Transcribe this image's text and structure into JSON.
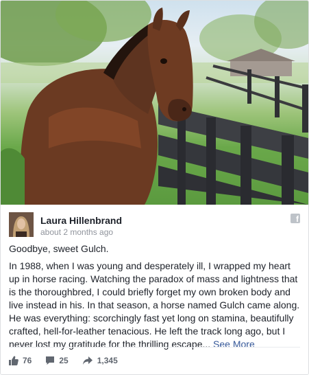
{
  "post": {
    "author": "Laura Hillenbrand",
    "timestamp": "about 2 months ago",
    "intro": "Goodbye, sweet Gulch.",
    "body": "In 1988, when I was young and desperately ill, I wrapped my heart up in horse racing. Watching the paradox of mass and lightness that is the thoroughbred, I could briefly forget my own broken body and live instead in his. In that season, a horse named Gulch came along. He was everything: scorchingly fast yet long on stamina, beautifully crafted, hell-for-leather tenacious. He left the track long ago, but I never lost my gratitude for the thrilling escape...",
    "see_more": "See More",
    "platform_icon": "facebook-f-icon"
  },
  "stats": {
    "likes": "76",
    "comments": "25",
    "shares": "1,345",
    "icons": [
      "thumbs-up-icon",
      "comment-icon",
      "share-arrow-icon"
    ]
  },
  "colors": {
    "link": "#365899",
    "meta": "#90949c",
    "stat": "#616770",
    "text": "#1d2129"
  }
}
